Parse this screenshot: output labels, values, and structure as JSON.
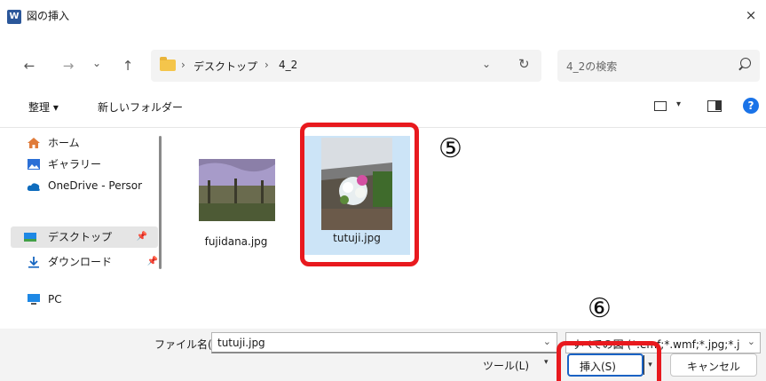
{
  "window": {
    "app_icon": "W",
    "title": "図の挿入",
    "close_glyph": "×"
  },
  "nav": {
    "back_glyph": "←",
    "forward_glyph": "→",
    "recent_glyph": "⌄",
    "up_glyph": "↑",
    "crumb_sep": "›",
    "breadcrumb": [
      "デスクトップ",
      "4_2"
    ],
    "address_chevron": "⌄",
    "refresh_glyph": "↻",
    "search_placeholder": "4_2の検索"
  },
  "commands": {
    "organize": "整理 ▾",
    "new_folder": "新しいフォルダー",
    "view_drop": "▾",
    "help": "?"
  },
  "sidebar": {
    "items": [
      {
        "label": "ホーム",
        "icon": "home-icon"
      },
      {
        "label": "ギャラリー",
        "icon": "gallery-icon"
      },
      {
        "label": "OneDrive - Persor",
        "icon": "onedrive-icon"
      },
      {
        "label": "デスクトップ",
        "icon": "desktop-icon",
        "pinned": "📌"
      },
      {
        "label": "ダウンロード",
        "icon": "download-icon",
        "pinned": "📌"
      },
      {
        "label": "PC",
        "icon": "pc-icon"
      }
    ]
  },
  "files": [
    {
      "name": "fujidana.jpg",
      "selected": false
    },
    {
      "name": "tutuji.jpg",
      "selected": true
    }
  ],
  "annotations": {
    "step5": "⑤",
    "step6": "⑥",
    "highlight_color": "#e8191e"
  },
  "bottom": {
    "filename_label": "ファイル名(N):",
    "filename_value": "tutuji.jpg",
    "chevron": "⌄",
    "filetype_value": "すべての図 (*.emf;*.wmf;*.jpg;*.j|",
    "tools_label": "ツール(L)",
    "tools_drop": "▾",
    "insert_label": "挿入(S)",
    "insert_split": "▾",
    "cancel_label": "キャンセル"
  }
}
